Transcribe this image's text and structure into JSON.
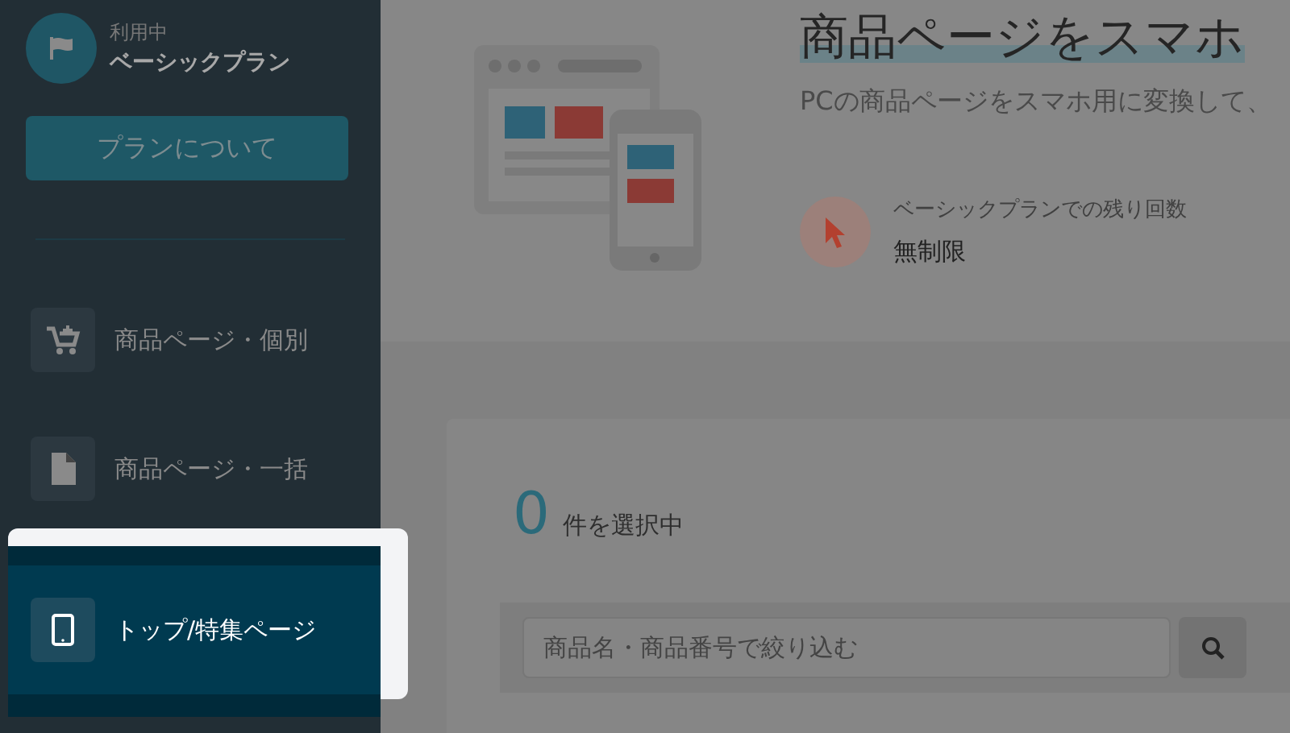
{
  "plan": {
    "status": "利用中",
    "name": "ベーシックプラン",
    "button": "プランについて"
  },
  "sidebar": {
    "items": [
      {
        "label": "商品ページ・個別",
        "selected": false
      },
      {
        "label": "商品ページ・一括",
        "selected": false
      },
      {
        "label": "トップ/特集ページ",
        "selected": true
      }
    ]
  },
  "hero": {
    "title": "商品ページをスマホ",
    "subtitle": "PCの商品ページをスマホ用に変換して、",
    "remaining_label": "ベーシックプランでの残り回数",
    "remaining_value": "無制限"
  },
  "selection": {
    "count": "0",
    "label": "件を選択中"
  },
  "search": {
    "placeholder": "商品名・商品番号で絞り込む"
  }
}
